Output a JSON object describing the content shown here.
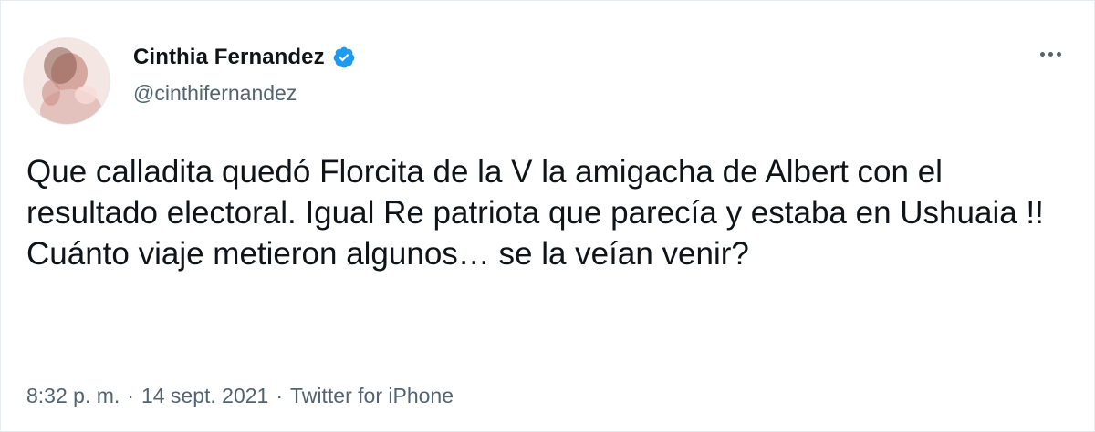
{
  "tweet": {
    "author": {
      "display_name": "Cinthia Fernandez",
      "handle": "@cinthifernandez",
      "verified": true,
      "verified_icon": "verified-badge-icon",
      "avatar_icon": "profile-photo"
    },
    "more_icon": "more-horizontal-icon",
    "text": "Que calladita quedó Florcita de la V la amigacha de Albert con el resultado electoral. Igual Re patriota que parecía y estaba en Ushuaia !! Cuánto viaje metieron algunos… se la veían venir?",
    "time": "8:32 p. m.",
    "separator": "·",
    "date": "14 sept. 2021",
    "source": "Twitter for iPhone"
  },
  "colors": {
    "text_primary": "#0f1419",
    "text_secondary": "#536471",
    "verified_blue": "#1d9bf0",
    "border": "#e6ecf0"
  }
}
